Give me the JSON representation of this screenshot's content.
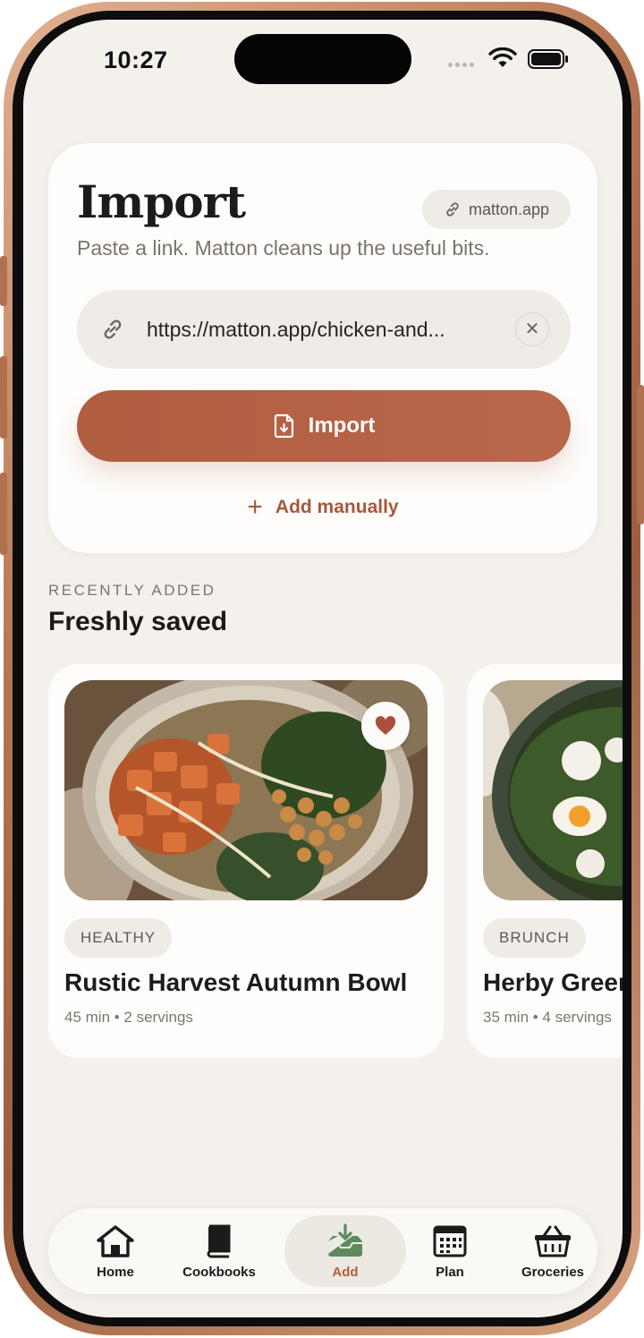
{
  "status_bar": {
    "time": "10:27"
  },
  "import_card": {
    "title": "Import",
    "domain_chip": "matton.app",
    "subtitle": "Paste a link. Matton cleans up the useful bits.",
    "url_value": "https://matton.app/chicken-and...",
    "clear_glyph": "✕",
    "import_button": "Import",
    "add_manually": "Add manually",
    "plus_glyph": "+"
  },
  "recent": {
    "eyebrow": "RECENTLY ADDED",
    "title": "Freshly saved",
    "recipes": [
      {
        "tag": "HEALTHY",
        "name": "Rustic Harvest Autumn Bowl",
        "meta": "45 min • 2 servings",
        "favorited": true
      },
      {
        "tag": "BRUNCH",
        "name": "Herby Green Shakshuka",
        "meta": "35 min • 4 servings",
        "favorited": false
      }
    ]
  },
  "tab_bar": {
    "active": "Add",
    "tabs": [
      {
        "label": "Home",
        "icon": "home-icon"
      },
      {
        "label": "Cookbooks",
        "icon": "book-icon"
      },
      {
        "label": "Add",
        "icon": "inbox-download-icon"
      },
      {
        "label": "Plan",
        "icon": "calendar-icon"
      },
      {
        "label": "Groceries",
        "icon": "basket-icon"
      }
    ]
  },
  "colors": {
    "accent": "#b15d40",
    "accent_text": "#a7583b",
    "active_tab_icon": "#5e8a5c",
    "background": "#f4f1ec",
    "card": "#fefdfb",
    "chip": "#efebe6",
    "frame": "#b57552"
  }
}
